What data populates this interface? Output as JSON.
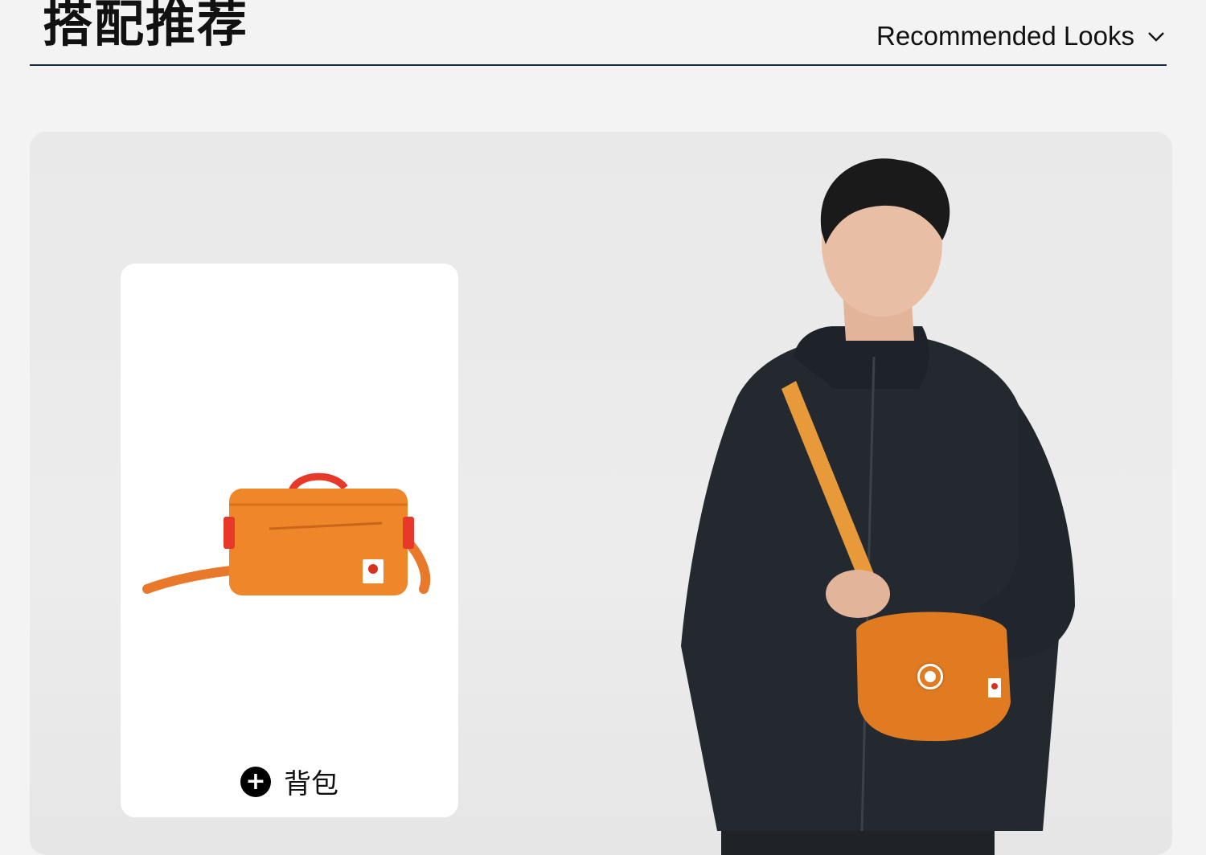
{
  "header": {
    "title": "搭配推荐",
    "toggle_label": "Recommended Looks",
    "toggle_icon": "chevron-down-icon",
    "divider_color": "#1a2a44"
  },
  "look": {
    "background_color": "#e9e9e9",
    "product_card": {
      "label": "背包",
      "icon": "plus-circle-icon",
      "product_color": "#f0862a",
      "accent_color": "#e8382a"
    },
    "model": {
      "jacket_color": "#23292f",
      "bag_color": "#e07b22"
    },
    "hotspot_icon": "target-icon"
  }
}
